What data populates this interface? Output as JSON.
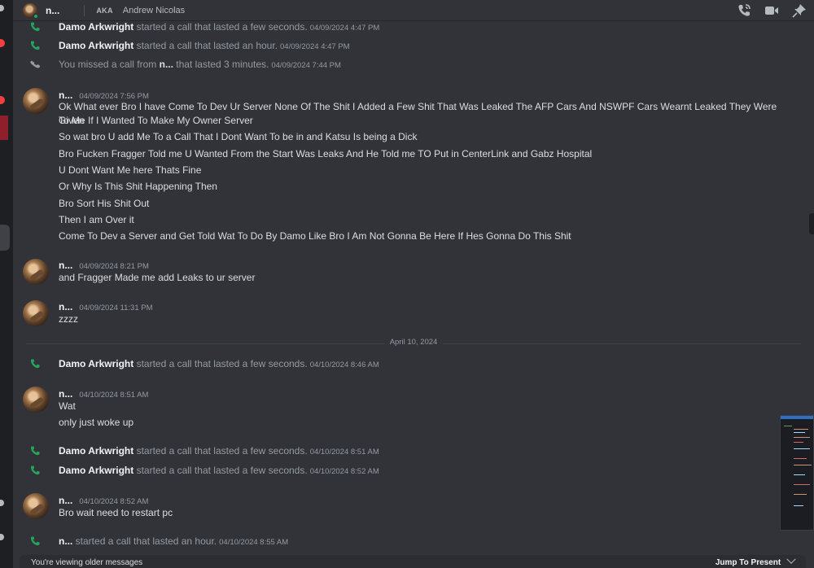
{
  "header": {
    "name": "n...",
    "aka_label": "AKA",
    "nickname": "Andrew Nicolas",
    "icons": [
      "voice-call-icon",
      "video-call-icon",
      "pin-icon"
    ]
  },
  "messages": {
    "call1": {
      "who": "Damo Arkwright",
      "action": " started a call that lasted a few seconds.",
      "ts": "04/09/2024 4:47 PM"
    },
    "call2": {
      "who": "Damo Arkwright",
      "action": " started a call that lasted an hour.",
      "ts": "04/09/2024 4:47 PM"
    },
    "call3": {
      "pre": "You missed a call from ",
      "who": "n...",
      "action": " that lasted 3 minutes.",
      "ts": "04/09/2024 7:44 PM"
    },
    "group1": {
      "author": "n...",
      "ts": "04/09/2024 7:56 PM",
      "lines": [
        "Ok What ever Bro I have Come To Dev Ur Server None Of The Shit I Added a Few Shit That Was Leaked The AFP Cars And NSWPF Cars Wearnt Leaked They Were Given",
        "To Me If I Wanted To Make My Owner Server",
        "So wat bro U add Me To a Call That I Dont Want To be in and Katsu Is being a Dick",
        "Bro Fucken Fragger Told me U Wanted From the Start Was Leaks And He Told me TO Put in CenterLink and Gabz Hospital",
        "U Dont Want Me here Thats Fine",
        "Or Why Is This Shit Happening Then",
        "Bro Sort His Shit Out",
        "Then I am Over it",
        "Come To Dev a Server and Get Told Wat To Do By Damo Like Bro I Am Not Gonna Be Here If Hes Gonna Do This Shit"
      ]
    },
    "group2": {
      "author": "n...",
      "ts": "04/09/2024 8:21 PM",
      "lines": [
        "and Fragger Made me add Leaks to ur server"
      ]
    },
    "group3": {
      "author": "n...",
      "ts": "04/09/2024 11:31 PM",
      "lines": [
        "zzzz"
      ]
    },
    "date_divider": "April 10, 2024",
    "call4": {
      "who": "Damo Arkwright",
      "action": " started a call that lasted a few seconds.",
      "ts": "04/10/2024 8:46 AM"
    },
    "group4": {
      "author": "n...",
      "ts": "04/10/2024 8:51 AM",
      "lines": [
        "Wat",
        "only just woke up"
      ]
    },
    "call5": {
      "who": "Damo Arkwright",
      "action": " started a call that lasted a few seconds.",
      "ts": "04/10/2024 8:51 AM"
    },
    "call6": {
      "who": "Damo Arkwright",
      "action": " started a call that lasted a few seconds.",
      "ts": "04/10/2024 8:52 AM"
    },
    "group5": {
      "author": "n...",
      "ts": "04/10/2024 8:52 AM",
      "lines": [
        "Bro wait need to restart pc"
      ]
    },
    "call7": {
      "who": "n...",
      "action": " started a call that lasted an hour.",
      "ts": "04/10/2024 8:55 AM"
    }
  },
  "footer": {
    "older_text": "You're viewing older messages",
    "jump_label": "Jump To Present",
    "jump_icon": "chevron-down-icon"
  },
  "colors": {
    "background": "#313338",
    "call_green": "#23a55a",
    "missed_gray": "#949ba4",
    "online": "#23a55a"
  }
}
